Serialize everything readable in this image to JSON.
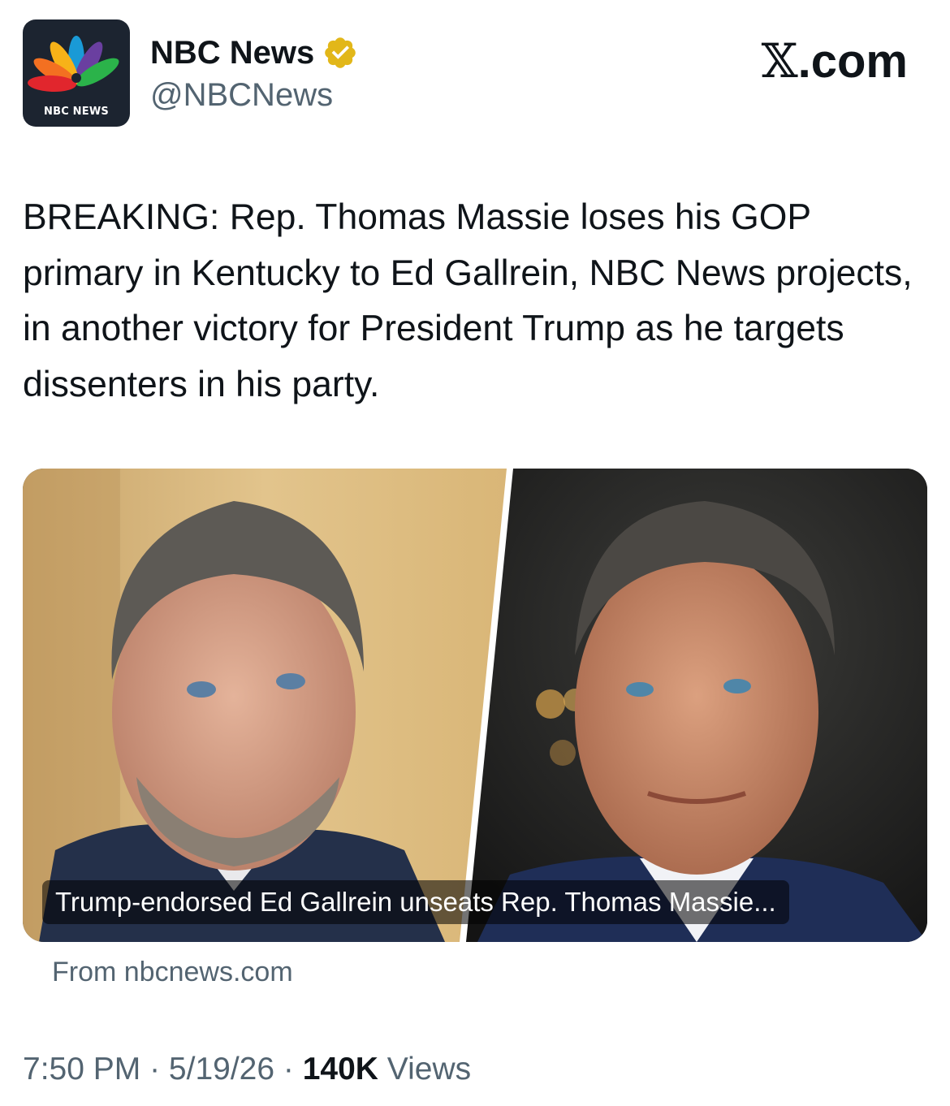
{
  "header": {
    "avatar_text": "NBC NEWS",
    "display_name": "NBC News",
    "handle": "@NBCNews",
    "verified_badge_icon": "verified-badge-icon",
    "badge_color": "#e2b719"
  },
  "brand": {
    "mark": "𝕏",
    "suffix": ".com"
  },
  "tweet": {
    "text": "BREAKING: Rep. Thomas Massie loses his GOP primary in Kentucky to Ed Gallrein, NBC News projects, in another victory for President Trump as he targets dissenters in his party."
  },
  "card": {
    "caption": "Trump-endorsed Ed Gallrein unseats Rep. Thomas Massie...",
    "source": "From nbcnews.com"
  },
  "meta": {
    "time": "7:50 PM",
    "separator": " · ",
    "date": "5/19/26",
    "views_count": "140K",
    "views_label": " Views"
  },
  "colors": {
    "text_primary": "#0f1419",
    "text_secondary": "#536471",
    "avatar_bg": "#1c2430"
  }
}
